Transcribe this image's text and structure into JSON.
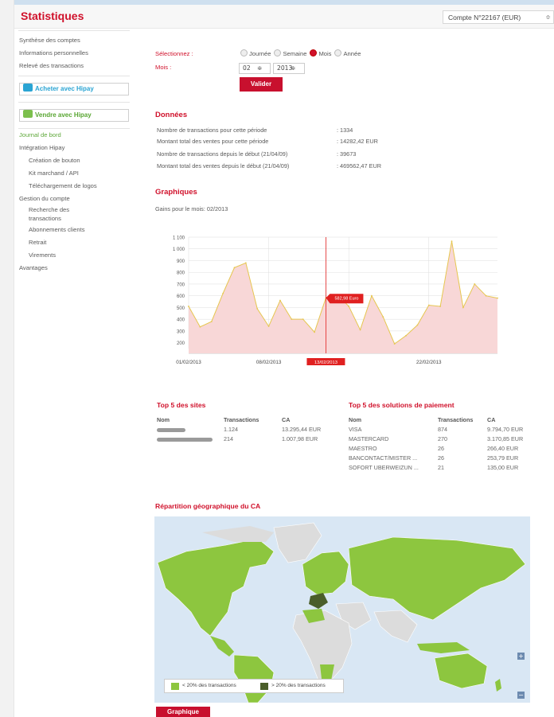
{
  "header": {
    "title": "Statistiques",
    "account": "Compte N°22167 (EUR)",
    "account_chev": "≑"
  },
  "sidebar": {
    "top_items": [
      "Synthèse des comptes",
      "Informations personnelles",
      "Relevé des transactions"
    ],
    "buy_button": "Acheter avec Hipay",
    "sell_button": "Vendre avec Hipay",
    "items": [
      {
        "label": "Journal de bord",
        "level": 0,
        "active": true
      },
      {
        "label": "Intégration Hipay",
        "level": 0
      },
      {
        "label": "Création de bouton",
        "level": 1
      },
      {
        "label": "Kit marchand / API",
        "level": 1
      },
      {
        "label": "Téléchargement de logos",
        "level": 1
      },
      {
        "label": "Gestion du compte",
        "level": 0
      },
      {
        "label": "Recherche des",
        "level": 1
      },
      {
        "label": "transactions",
        "level": 1
      },
      {
        "label": "Abonnements clients",
        "level": 1
      },
      {
        "label": "Retrait",
        "level": 1
      },
      {
        "label": "Virements",
        "level": 1
      },
      {
        "label": "Avantages",
        "level": 0
      }
    ]
  },
  "form": {
    "select_label": "Sélectionnez :",
    "month_label": "Mois :",
    "periods": [
      {
        "label": "Journée",
        "selected": false
      },
      {
        "label": "Semaine",
        "selected": false
      },
      {
        "label": "Mois",
        "selected": true
      },
      {
        "label": "Année",
        "selected": false
      }
    ],
    "month_value": "02",
    "year_value": "2013",
    "spin": "≑",
    "submit": "Valider"
  },
  "donnees": {
    "title": "Données",
    "rows": [
      {
        "label": "Nombre de transactions pour cette période",
        "value": ": 1334"
      },
      {
        "label": "Montant total des ventes pour cette période",
        "value": ": 14282,42 EUR"
      },
      {
        "label": "Nombre de transactions depuis le début (21/04/09)",
        "value": ": 39673"
      },
      {
        "label": "Montant total des ventes depuis le début (21/04/09)",
        "value": ": 469562,47 EUR"
      }
    ]
  },
  "graphiques": {
    "title": "Graphiques",
    "subtitle": "Gains pour le mois: 02/2013"
  },
  "chart_data": {
    "type": "area",
    "title": "",
    "xlabel": "",
    "ylabel": "",
    "ylim": [
      150,
      1100
    ],
    "y_ticks": [
      "1 100",
      "1 000",
      "900",
      "800",
      "700",
      "600",
      "500",
      "400",
      "300",
      "200"
    ],
    "x_ticks": [
      "01/02/2013",
      "08/02/2013",
      "",
      "22/02/2013"
    ],
    "x_values": [
      "01/02",
      "02/02",
      "03/02",
      "04/02",
      "05/02",
      "06/02",
      "07/02",
      "08/02",
      "09/02",
      "10/02",
      "11/02",
      "12/02",
      "13/02",
      "14/02",
      "15/02",
      "16/02",
      "17/02",
      "18/02",
      "19/02",
      "20/02",
      "21/02",
      "22/02",
      "23/02",
      "24/02",
      "25/02",
      "26/02",
      "27/02",
      "28/02"
    ],
    "values": [
      510,
      335,
      380,
      620,
      840,
      880,
      490,
      340,
      560,
      400,
      400,
      290,
      583,
      610,
      510,
      310,
      600,
      420,
      190,
      260,
      350,
      520,
      510,
      1065,
      500,
      700,
      600,
      580
    ],
    "highlight": {
      "index": 12,
      "date_label": "13/02/2013",
      "value_label": "582,98 Euro"
    },
    "colors": {
      "fill": "#f8d7d7",
      "line": "#e6c64f",
      "highlight": "#e02020",
      "grid": "#dddddd"
    }
  },
  "top_sites": {
    "title": "Top 5 des sites",
    "headers": [
      "Nom",
      "Transactions",
      "CA"
    ],
    "rows": [
      {
        "transactions": "1.124",
        "ca": "13.295,44 EUR"
      },
      {
        "transactions": "214",
        "ca": "1.007,98 EUR"
      }
    ]
  },
  "top_payments": {
    "title": "Top 5 des solutions de paiement",
    "headers": [
      "Nom",
      "Transactions",
      "CA"
    ],
    "rows": [
      {
        "nom": "VISA",
        "transactions": "874",
        "ca": "9.794,70 EUR"
      },
      {
        "nom": "MASTERCARD",
        "transactions": "270",
        "ca": "3.170,85 EUR"
      },
      {
        "nom": "MAESTRO",
        "transactions": "26",
        "ca": "266,40 EUR"
      },
      {
        "nom": "BANCONTACT/MISTER ...",
        "transactions": "26",
        "ca": "253,79 EUR"
      },
      {
        "nom": "SOFORT UBERWEIZUN ...",
        "transactions": "21",
        "ca": "135,00 EUR"
      }
    ]
  },
  "geo": {
    "title": "Répartition géographique du CA",
    "legend_low": "< 20% des transactions",
    "legend_high": "> 20% des transactions",
    "zoom_in": "+",
    "zoom_out": "−",
    "colors": {
      "ocean": "#d9e7f4",
      "land": "#dcdcdc",
      "low": "#8dc63f",
      "high": "#4a5e2a"
    }
  },
  "footer": {
    "graph_button": "Graphique"
  }
}
